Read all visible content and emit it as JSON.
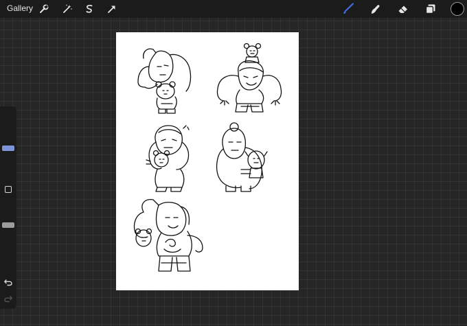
{
  "topbar": {
    "gallery_label": "Gallery",
    "left_tools": [
      "wrench-icon",
      "magic-wand-icon",
      "selection-icon",
      "transform-arrow-icon"
    ],
    "right_tools": [
      "brush-icon",
      "smudge-icon",
      "eraser-icon",
      "layers-icon"
    ],
    "active_tool": "brush-icon",
    "active_color": "#000000",
    "accent_color": "#3d6fe0"
  },
  "sidebar": {
    "brush_size_level": 0.37,
    "opacity_level": 0.64,
    "icons": [
      "modify-square-icon",
      "undo-icon",
      "redo-icon"
    ]
  },
  "canvas": {
    "background": "#ffffff",
    "sketches": [
      "chibi-flexing-with-bear",
      "chibi-big-arms-with-small-bear-on-head",
      "chibi-holding-bear",
      "chibi-large-holding-doll",
      "chibi-tattooed-flexing-with-bear"
    ]
  }
}
